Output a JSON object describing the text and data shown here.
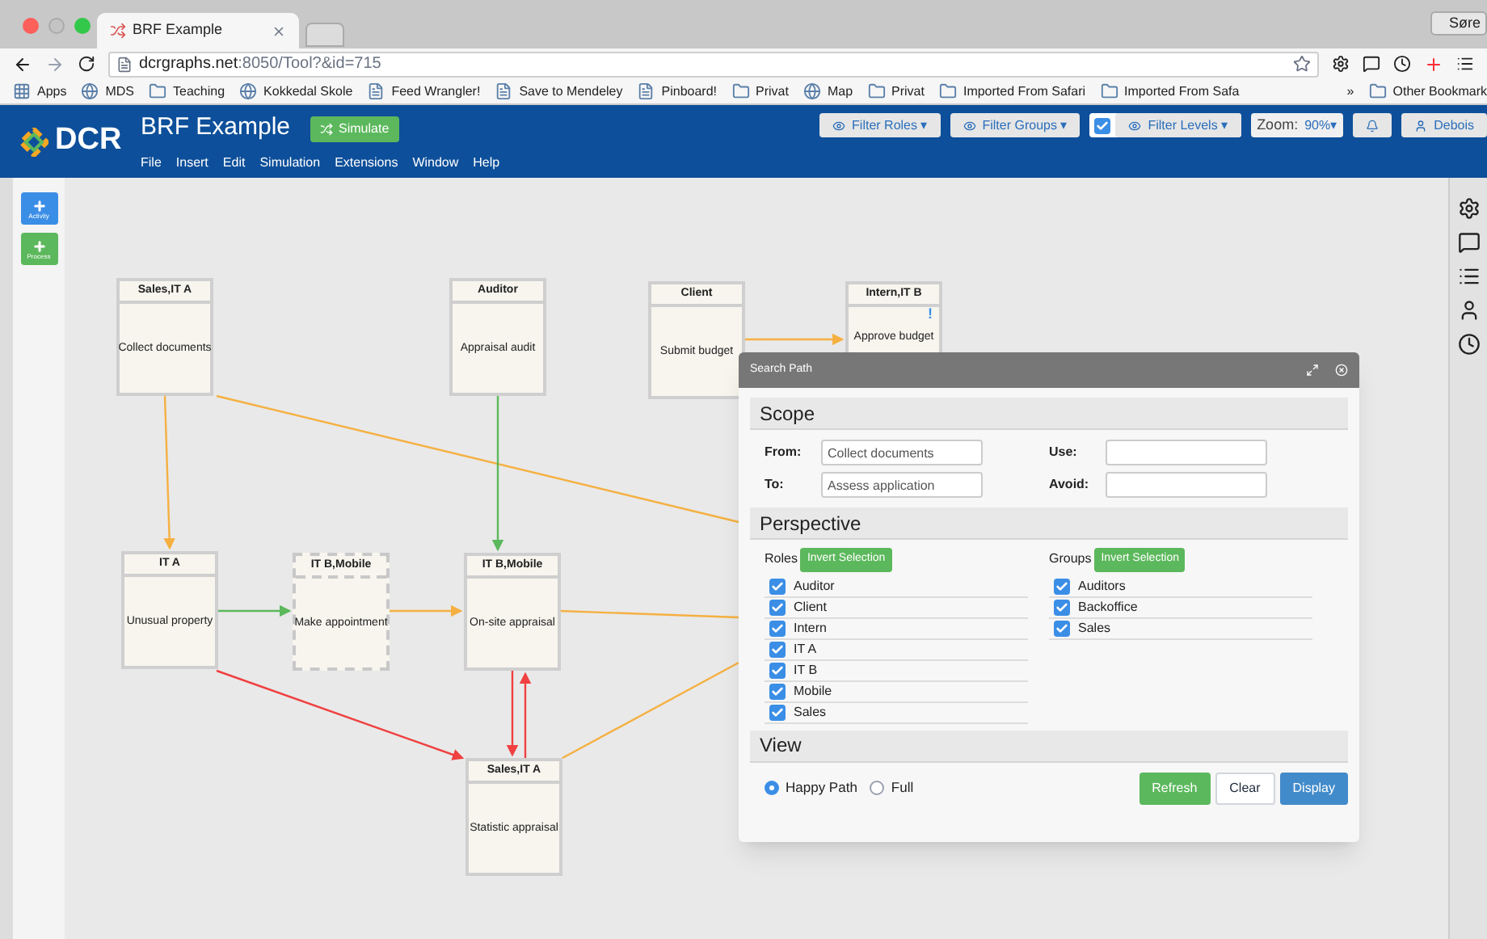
{
  "browser": {
    "tab_title": "BRF Example",
    "profile": "Søre",
    "url_host": "dcrgraphs.net",
    "url_rest": ":8050/Tool?&id=715",
    "bookmarks": [
      {
        "label": "Apps",
        "kind": "apps"
      },
      {
        "label": "MDS",
        "kind": "site"
      },
      {
        "label": "Teaching",
        "kind": "folder"
      },
      {
        "label": "Kokkedal Skole",
        "kind": "site"
      },
      {
        "label": "Feed Wrangler!",
        "kind": "page"
      },
      {
        "label": "Save to Mendeley",
        "kind": "page"
      },
      {
        "label": "Pinboard!",
        "kind": "page"
      },
      {
        "label": "Privat",
        "kind": "folder"
      },
      {
        "label": "Map",
        "kind": "site"
      },
      {
        "label": "Privat",
        "kind": "folder"
      },
      {
        "label": "Imported From Safari",
        "kind": "folder"
      },
      {
        "label": "Imported From Safa",
        "kind": "folder"
      }
    ],
    "more": "»",
    "other": "Other Bookmark"
  },
  "app": {
    "logo": "DCR",
    "title": "BRF Example",
    "simulate": "Simulate",
    "menu": [
      "File",
      "Insert",
      "Edit",
      "Simulation",
      "Extensions",
      "Window",
      "Help"
    ],
    "filter_roles": "Filter Roles",
    "filter_groups": "Filter Groups",
    "filter_levels_checked": true,
    "filter_levels": "Filter Levels",
    "carets": [
      "▾",
      "▾",
      "▾",
      "▾"
    ],
    "zoom_label": "Zoom:",
    "zoom_value": "90%",
    "user": "Debois"
  },
  "toolbar": [
    "Activity",
    "Process"
  ],
  "activities": [
    {
      "role": "Sales,IT A",
      "name": "Collect documents",
      "dashed": false
    },
    {
      "role": "Auditor",
      "name": "Appraisal audit",
      "dashed": false
    },
    {
      "role": "Client",
      "name": "Submit budget",
      "dashed": false
    },
    {
      "role": "Intern,IT B",
      "name": "Approve budget",
      "badge": "!",
      "dashed": false
    },
    {
      "role": "IT A",
      "name": "Unusual property",
      "dashed": false
    },
    {
      "role": "IT B,Mobile",
      "name": "Make appointment",
      "dashed": true
    },
    {
      "role": "IT B,Mobile",
      "name": "On-site appraisal",
      "dashed": false
    },
    {
      "role": "Sales,IT A",
      "name": "Statistic appraisal",
      "dashed": false
    }
  ],
  "dialog": {
    "title": "Search Path",
    "scope": {
      "heading": "Scope",
      "from_label": "From:",
      "from_value": "Collect documents",
      "to_label": "To:",
      "to_value": "Assess application",
      "use_label": "Use:",
      "avoid_label": "Avoid:"
    },
    "perspective": {
      "heading": "Perspective",
      "roles_label": "Roles",
      "groups_label": "Groups",
      "invert": "Invert Selection",
      "invert_groups": "Invert Selection",
      "roles": [
        {
          "label": "Auditor",
          "checked": true
        },
        {
          "label": "Client",
          "checked": true
        },
        {
          "label": "Intern",
          "checked": true
        },
        {
          "label": "IT A",
          "checked": true
        },
        {
          "label": "IT B",
          "checked": true
        },
        {
          "label": "Mobile",
          "checked": true
        },
        {
          "label": "Sales",
          "checked": true
        }
      ],
      "groups": [
        {
          "label": "Auditors",
          "checked": true
        },
        {
          "label": "Backoffice",
          "checked": true
        },
        {
          "label": "Sales",
          "checked": true
        }
      ]
    },
    "view": {
      "heading": "View",
      "options": [
        {
          "label": "Happy Path",
          "selected": true
        },
        {
          "label": "Full",
          "selected": false
        }
      ]
    },
    "buttons": [
      {
        "label": "Refresh",
        "kind": "success"
      },
      {
        "label": "Clear",
        "kind": "default"
      },
      {
        "label": "Display",
        "kind": "primary"
      }
    ]
  }
}
